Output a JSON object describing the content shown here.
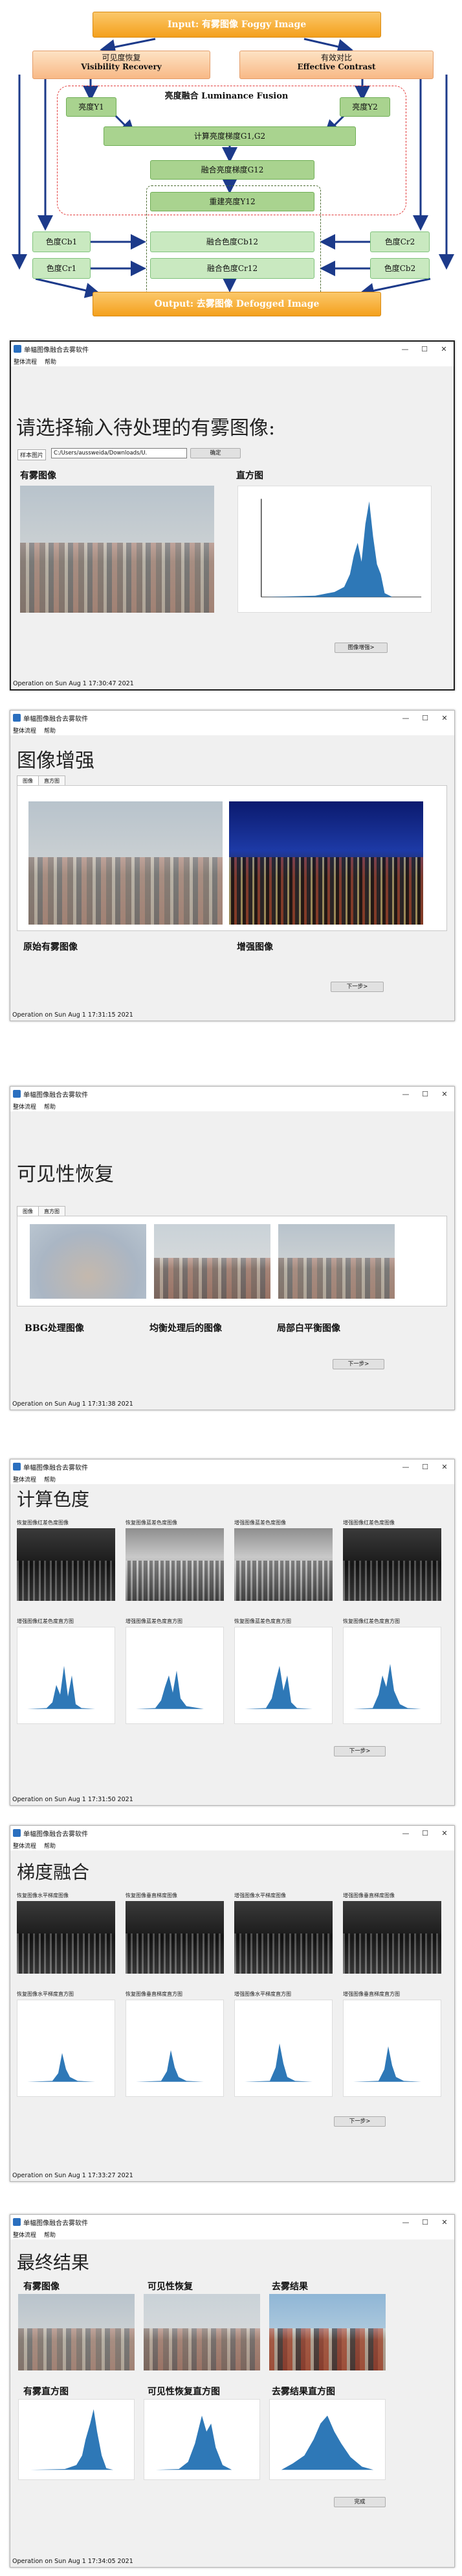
{
  "diagram": {
    "input": "Input: 有雾图像 Foggy Image",
    "vis_cn": "可见度恢复",
    "vis_en": "Visibility Recovery",
    "con_cn": "有效对比",
    "con_en": "Effective Contrast",
    "y1": "亮度Y1",
    "y2": "亮度Y2",
    "fusion": "亮度融合 Luminance Fusion",
    "grad": "计算亮度梯度G1,G2",
    "fgrad": "融合亮度梯度G12",
    "rebuild": "重建亮度Y12",
    "cb1": "色度Cb1",
    "cr1": "色度Cr1",
    "cr2": "色度Cr2",
    "cb2": "色度Cb2",
    "fcb": "融合色度Cb12",
    "fcr": "融合色度Cr12",
    "output": "Output: 去雾图像 Defogged Image"
  },
  "app": {
    "title": "单幅图像融合去雾软件",
    "menu_flow": "整体流程",
    "menu_help": "帮助"
  },
  "win1": {
    "heading": "请选择输入待处理的有雾图像:",
    "file_label": "样本图片",
    "file_value": "C:/Users/aussweida/Downloads/U.",
    "ok": "确定",
    "cap_foggy": "有雾图像",
    "cap_hist": "直方图",
    "next": "图像增强>",
    "status": "Operation on Sun Aug  1 17:30:47 2021"
  },
  "win2": {
    "heading": "图像增强",
    "tab_img": "图像",
    "tab_hist": "直方图",
    "cap_orig": "原始有雾图像",
    "cap_enh": "增强图像",
    "next": "下一步>",
    "status": "Operation on Sun Aug  1 17:31:15 2021"
  },
  "win3": {
    "heading": "可见性恢复",
    "tab_img": "图像",
    "tab_hist": "直方图",
    "cap_bbg": "BBG处理图像",
    "cap_eq": "均衡处理后的图像",
    "cap_wb": "局部白平衡图像",
    "next": "下一步>",
    "status": "Operation on Sun Aug  1 17:31:38 2021"
  },
  "win4": {
    "heading": "计算色度",
    "labels_top": [
      "恢复图像红差色度图像",
      "恢复图像蓝差色度图像",
      "增强图像蓝差色度图像",
      "增强图像红差色度图像"
    ],
    "labels_bot": [
      "增强图像红差色度直方图",
      "增强图像蓝差色度直方图",
      "恢复图像蓝差色度直方图",
      "恢复图像红差色度直方图"
    ],
    "next": "下一步>",
    "status": "Operation on Sun Aug  1 17:31:50 2021"
  },
  "win5": {
    "heading": "梯度融合",
    "labels_top": [
      "恢复图像水平梯度图像",
      "恢复图像垂直梯度图像",
      "增强图像水平梯度图像",
      "增强图像垂直梯度图像"
    ],
    "labels_bot": [
      "恢复图像水平梯度直方图",
      "恢复图像垂直梯度直方图",
      "增强图像水平梯度直方图",
      "增强图像垂直梯度直方图"
    ],
    "next": "下一步>",
    "status": "Operation on Sun Aug  1 17:33:27 2021"
  },
  "win6": {
    "heading": "最终结果",
    "cap_foggy": "有雾图像",
    "cap_vis": "可见性恢复",
    "cap_res": "去雾结果",
    "cap_h1": "有雾直方图",
    "cap_h2": "可见性恢复直方图",
    "cap_h3": "去雾结果直方图",
    "done": "完成",
    "status": "Operation on Sun Aug  1 17:34:05 2021"
  }
}
